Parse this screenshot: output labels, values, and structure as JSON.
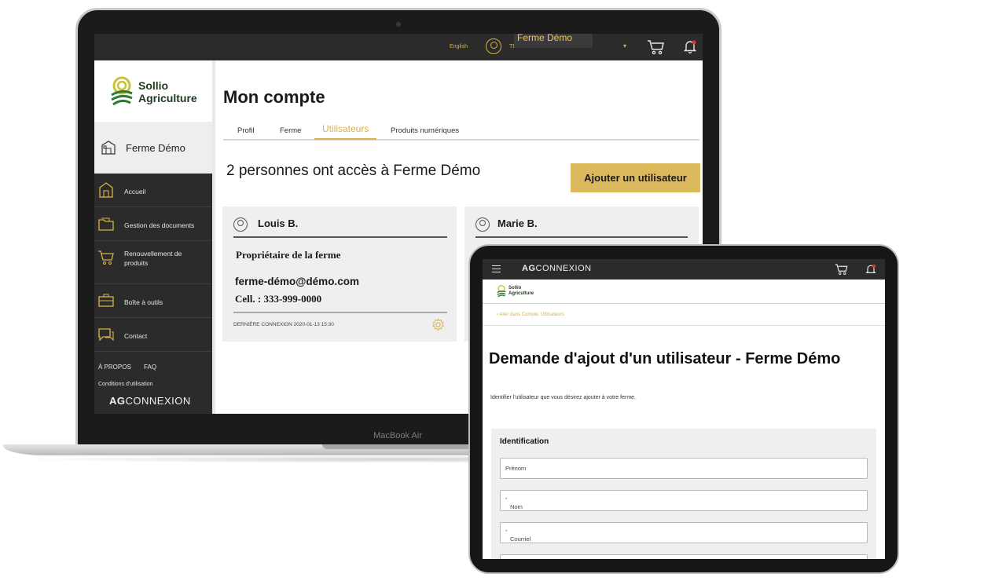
{
  "laptop": {
    "model_label": "MacBook Air",
    "topbar": {
      "language_link": "English",
      "user_name_truncated": "TE",
      "farm_selector_label": "Ferme Démo",
      "dropdown_caret": "▾"
    },
    "sidebar": {
      "logo_line1": "Sollio",
      "logo_line2": "Agriculture",
      "farm_name": "Ferme Démo",
      "nav_items": [
        {
          "label": "Accueil"
        },
        {
          "label": "Gestion des documents"
        },
        {
          "label": "Renouvellement de produits"
        },
        {
          "label": "Boîte à outils"
        },
        {
          "label": "Contact"
        }
      ],
      "footer_links": {
        "about": "À PROPOS",
        "faq": "FAQ",
        "terms": "Conditions d'utilisation"
      },
      "brand_ag": "AG",
      "brand_connexion": "CONNEXION"
    },
    "main": {
      "page_title": "Mon compte",
      "tabs": [
        "Profil",
        "Ferme",
        "Utilisateurs",
        "Produits numériques"
      ],
      "active_tab": "Utilisateurs",
      "access_text": "2 personnes ont accès à Ferme Démo",
      "add_user_button": "Ajouter un utilisateur",
      "users": [
        {
          "name": "Louis B.",
          "role": "Propriétaire de la ferme",
          "email": "ferme-démo@démo.com",
          "phone": "Cell. : 333-999-0000",
          "last_login": "DERNIÈRE CONNEXION 2020-01-13 15:30"
        },
        {
          "name": "Marie B."
        }
      ]
    }
  },
  "tablet": {
    "topbar": {
      "brand_ag": "AG",
      "brand_connexion": "CONNEXION"
    },
    "logo_line1": "Sollio",
    "logo_line2": "Agriculture",
    "back_link": "Aller dans Compte: Utilisateurs",
    "title": "Demande d'ajout d'un utilisateur - Ferme Démo",
    "subtitle": "Identifier l'utilisateur que vous désirez ajouter à votre ferme.",
    "form": {
      "section_title": "Identification",
      "fields": [
        {
          "label": "Prénom",
          "required": false
        },
        {
          "label": "Nom",
          "required": true
        },
        {
          "label": "Courriel",
          "required": true
        }
      ],
      "required_mark": "*"
    }
  },
  "colors": {
    "accent_gold": "#dcb95c",
    "dark_bar": "#2b2b2b",
    "brand_green": "#2e7d32",
    "brand_yellow": "#c8c23a",
    "alert_red": "#d33"
  }
}
